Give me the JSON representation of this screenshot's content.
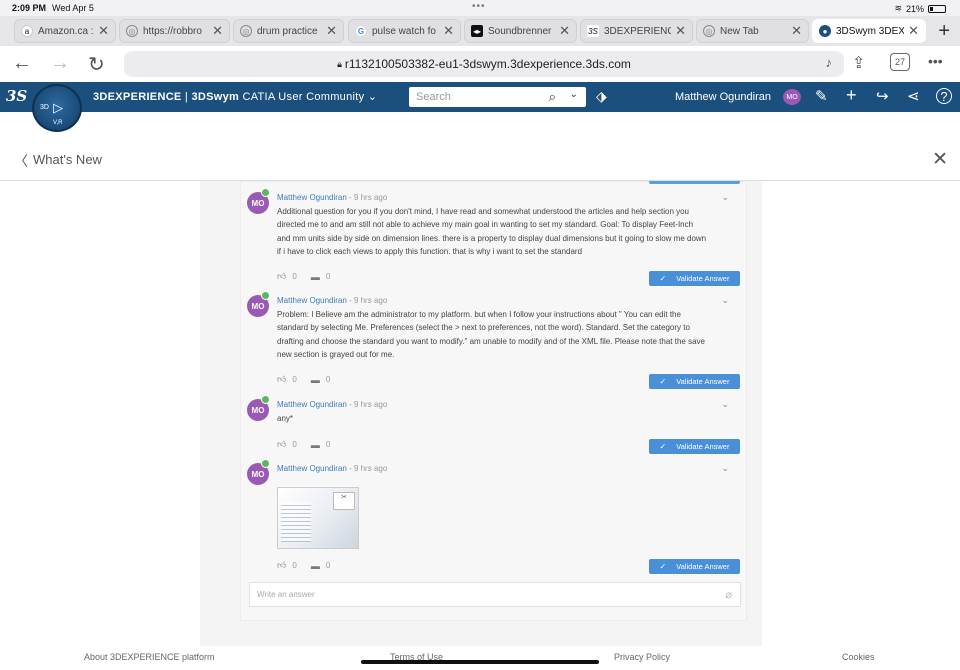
{
  "status_bar": {
    "time": "2:09 PM",
    "date": "Wed Apr 5",
    "battery": "21%"
  },
  "tabs": [
    {
      "label": "Amazon.ca : d",
      "icon": "amazon-icon"
    },
    {
      "label": "https://robbro",
      "icon": "globe-icon"
    },
    {
      "label": "drum practice",
      "icon": "globe-icon"
    },
    {
      "label": "pulse watch fo",
      "icon": "google-icon"
    },
    {
      "label": "Soundbrenner",
      "icon": "soundbrenner-icon"
    },
    {
      "label": "3DEXPERIENC",
      "icon": "3ds-icon"
    },
    {
      "label": "New Tab",
      "icon": "globe-icon"
    },
    {
      "label": "3DSwym 3DEX",
      "icon": "3dswym-icon",
      "active": true
    }
  ],
  "address_bar": {
    "url": "r1132100503382-eu1-3dswym.3dexperience.3ds.com",
    "tab_count": "27"
  },
  "app_bar": {
    "brand": "3DEXPERIENCE",
    "app": "3DSwym",
    "community": "CATIA User Community",
    "search_placeholder": "Search",
    "user_name": "Matthew Ogundiran",
    "user_initials": "MO",
    "compass_label": "3D",
    "compass_sub": "V,R"
  },
  "page_header": {
    "title": "What's New"
  },
  "comments": [
    {
      "initials": "MO",
      "author": "Matthew Ogundiran",
      "ago": " - 9 hrs ago",
      "body": "Additional question for you if you don't mind, I have read and somewhat understood the articles and help section you directed me to and am still not able to achieve my main goal in wanting to set my standard. Goal: To display Feet-Inch and mm units side by side on dimension lines. there is a property to display dual dimensions  but it going to slow me down if i have to click each views to apply this function. that is why i want to set the standard",
      "likes": "0",
      "replies": "0",
      "validate_label": "Validate Answer"
    },
    {
      "initials": "MO",
      "author": "Matthew Ogundiran",
      "ago": " - 9 hrs ago",
      "body": "Problem: I Believe am the administrator to my platform. but when I follow your instructions about \" You can edit the standard by selecting Me. Preferences (select the > next to preferences, not the word). Standard. Set the category to drafting and choose the standard you want to modify.\" am unable to modify and of the XML file. Please note that the save new section is grayed out for me.",
      "likes": "0",
      "replies": "0",
      "validate_label": "Validate Answer"
    },
    {
      "initials": "MO",
      "author": "Matthew Ogundiran",
      "ago": " - 9 hrs ago",
      "body": "any*",
      "likes": "0",
      "replies": "0",
      "validate_label": "Validate Answer"
    },
    {
      "initials": "MO",
      "author": "Matthew Ogundiran",
      "ago": " - 9 hrs ago",
      "body": "",
      "likes": "0",
      "replies": "0",
      "validate_label": "Validate Answer"
    }
  ],
  "answer_box": {
    "placeholder": "Write an answer"
  },
  "footer": {
    "about": "About 3DEXPERIENCE platform",
    "terms": "Terms of Use",
    "privacy": "Privacy Policy",
    "cookies": "Cookies"
  }
}
